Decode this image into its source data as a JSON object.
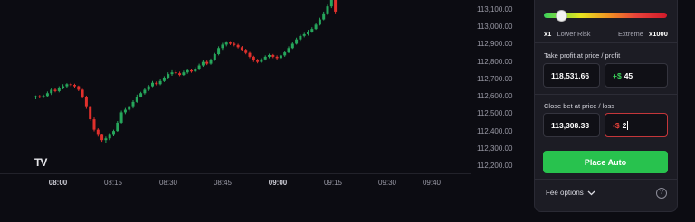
{
  "chart": {
    "price_ticks": [
      "113,100.00",
      "113,000.00",
      "112,900.00",
      "112,800.00",
      "112,700.00",
      "112,600.00",
      "112,500.00",
      "112,400.00",
      "112,300.00",
      "112,200.00"
    ],
    "time_ticks": [
      {
        "label": "08:00",
        "bold": true
      },
      {
        "label": "08:15",
        "bold": false
      },
      {
        "label": "08:30",
        "bold": false
      },
      {
        "label": "08:45",
        "bold": false
      },
      {
        "label": "09:00",
        "bold": true
      },
      {
        "label": "09:15",
        "bold": false
      },
      {
        "label": "09:30",
        "bold": false
      },
      {
        "label": "09:40",
        "bold": false
      }
    ],
    "logo_text": "TV",
    "up_color": "#26a65b",
    "down_color": "#e0302c",
    "price_axis_min": 112200,
    "price_axis_max": 113100,
    "candles": [
      [
        112596,
        112602,
        112585,
        112607
      ],
      [
        112602,
        112598,
        112590,
        112610
      ],
      [
        112598,
        112604,
        112592,
        112612
      ],
      [
        112604,
        112620,
        112600,
        112630
      ],
      [
        112620,
        112640,
        112610,
        112652
      ],
      [
        112640,
        112632,
        112625,
        112648
      ],
      [
        112632,
        112650,
        112625,
        112660
      ],
      [
        112650,
        112660,
        112642,
        112672
      ],
      [
        112660,
        112672,
        112650,
        112678
      ],
      [
        112672,
        112668,
        112660,
        112680
      ],
      [
        112668,
        112660,
        112652,
        112675
      ],
      [
        112660,
        112640,
        112632,
        112664
      ],
      [
        112640,
        112600,
        112590,
        112645
      ],
      [
        112600,
        112540,
        112530,
        112606
      ],
      [
        112540,
        112470,
        112460,
        112548
      ],
      [
        112470,
        112410,
        112400,
        112480
      ],
      [
        112410,
        112380,
        112370,
        112418
      ],
      [
        112380,
        112350,
        112340,
        112386
      ],
      [
        112350,
        112360,
        112330,
        112370
      ],
      [
        112360,
        112380,
        112350,
        112390
      ],
      [
        112380,
        112402,
        112372,
        112410
      ],
      [
        112402,
        112450,
        112398,
        112460
      ],
      [
        112450,
        112510,
        112445,
        112520
      ],
      [
        112510,
        112525,
        112500,
        112535
      ],
      [
        112525,
        112540,
        112515,
        112548
      ],
      [
        112540,
        112570,
        112532,
        112580
      ],
      [
        112570,
        112600,
        112565,
        112612
      ],
      [
        112600,
        112620,
        112595,
        112628
      ],
      [
        112620,
        112640,
        112612,
        112650
      ],
      [
        112640,
        112660,
        112632,
        112668
      ],
      [
        112660,
        112680,
        112655,
        112690
      ],
      [
        112680,
        112672,
        112665,
        112688
      ],
      [
        112672,
        112690,
        112666,
        112700
      ],
      [
        112690,
        112710,
        112684,
        112718
      ],
      [
        112710,
        112730,
        112702,
        112740
      ],
      [
        112730,
        112740,
        112720,
        112752
      ],
      [
        112740,
        112735,
        112728,
        112750
      ],
      [
        112735,
        112725,
        112718,
        112744
      ],
      [
        112725,
        112740,
        112720,
        112750
      ],
      [
        112740,
        112752,
        112732,
        112760
      ],
      [
        112752,
        112745,
        112738,
        112762
      ],
      [
        112745,
        112760,
        112740,
        112770
      ],
      [
        112760,
        112780,
        112752,
        112790
      ],
      [
        112780,
        112800,
        112772,
        112812
      ],
      [
        112800,
        112790,
        112782,
        112808
      ],
      [
        112790,
        112812,
        112784,
        112820
      ],
      [
        112812,
        112845,
        112806,
        112852
      ],
      [
        112845,
        112880,
        112838,
        112890
      ],
      [
        112880,
        112900,
        112870,
        112910
      ],
      [
        112900,
        112912,
        112890,
        112920
      ],
      [
        112912,
        112905,
        112898,
        112920
      ],
      [
        112905,
        112898,
        112890,
        112915
      ],
      [
        112898,
        112885,
        112878,
        112905
      ],
      [
        112885,
        112870,
        112862,
        112892
      ],
      [
        112870,
        112852,
        112844,
        112876
      ],
      [
        112852,
        112830,
        112822,
        112858
      ],
      [
        112830,
        112810,
        112800,
        112836
      ],
      [
        112810,
        112800,
        112792,
        112818
      ],
      [
        112800,
        112815,
        112795,
        112822
      ],
      [
        112815,
        112830,
        112808,
        112838
      ],
      [
        112830,
        112840,
        112822,
        112848
      ],
      [
        112840,
        112830,
        112822,
        112846
      ],
      [
        112830,
        112822,
        112814,
        112838
      ],
      [
        112822,
        112838,
        112816,
        112846
      ],
      [
        112838,
        112855,
        112830,
        112862
      ],
      [
        112855,
        112880,
        112850,
        112890
      ],
      [
        112880,
        112905,
        112875,
        112915
      ],
      [
        112905,
        112930,
        112900,
        112940
      ],
      [
        112930,
        112950,
        112922,
        112958
      ],
      [
        112950,
        112960,
        112942,
        112968
      ],
      [
        112960,
        112975,
        112952,
        112985
      ],
      [
        112975,
        112990,
        112968,
        113000
      ],
      [
        112990,
        113015,
        112985,
        113025
      ],
      [
        113015,
        113045,
        113010,
        113055
      ],
      [
        113045,
        113080,
        113040,
        113090
      ],
      [
        113080,
        113120,
        113070,
        113135
      ],
      [
        113120,
        113160,
        113110,
        113175
      ],
      [
        113160,
        113090,
        113080,
        113170
      ]
    ]
  },
  "panel": {
    "leverage_value": "x1",
    "leverage_left_label": "Lower Risk",
    "leverage_right_label": "Extreme",
    "leverage_max": "x1000",
    "leverage_fraction": 0.0,
    "take_profit_label": "Take profit at price / profit",
    "take_profit_price": "118,531.66",
    "take_profit_prefix": "+$",
    "take_profit_amount": "45",
    "close_bet_label": "Close bet at price / loss",
    "close_bet_price": "113,308.33",
    "close_bet_prefix": "-$",
    "close_bet_amount": "2",
    "place_button": "Place Auto",
    "fee_options": "Fee options",
    "help_glyph": "?"
  }
}
